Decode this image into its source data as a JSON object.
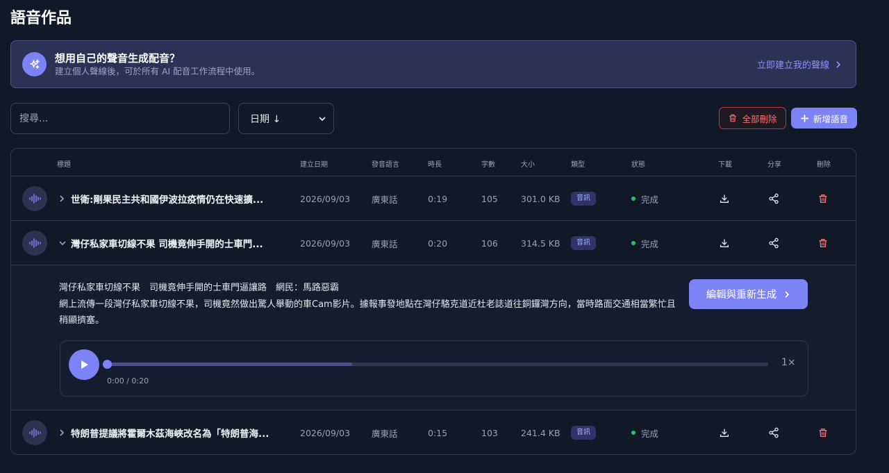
{
  "page": {
    "title": "語音作品"
  },
  "banner": {
    "title": "想用自己的聲音生成配音？",
    "subtitle": "建立個人聲線後，可於所有 AI 配音工作流程中使用。",
    "link_label": "立即建立我的聲線",
    "icon": "sparkles-icon"
  },
  "toolbar": {
    "search_placeholder": "搜尋...",
    "sort_label": "日期 ↓",
    "delete_all_label": "全部刪除",
    "new_label": "新增語音"
  },
  "table": {
    "headers": {
      "title": "標題",
      "date": "建立日期",
      "language": "發音語言",
      "duration": "時長",
      "chars": "字數",
      "size": "大小",
      "type": "類型",
      "status": "狀態",
      "download": "下載",
      "share": "分享",
      "delete": "刪除"
    },
    "rows": [
      {
        "title": "世衛:剛果民主共和國伊波拉疫情仍在快速擴...",
        "date": "2026/09/03",
        "language": "廣東話",
        "duration": "0:19",
        "chars": "105",
        "size": "301.0 KB",
        "type": "音訊",
        "status": "完成",
        "expanded": false
      },
      {
        "title": "灣仔私家車切線不果 司機竟伸手開的士車門...",
        "date": "2026/09/03",
        "language": "廣東話",
        "duration": "0:20",
        "chars": "106",
        "size": "314.5 KB",
        "type": "音訊",
        "status": "完成",
        "expanded": true
      },
      {
        "title": "特朗普提議將霍爾木茲海峽改名為「特朗普海...",
        "date": "2026/09/03",
        "language": "廣東話",
        "duration": "0:15",
        "chars": "103",
        "size": "241.4 KB",
        "type": "音訊",
        "status": "完成",
        "expanded": false
      }
    ]
  },
  "expanded": {
    "full_title": "灣仔私家車切線不果　司機竟伸手開的士車門逼讓路　網民：馬路惡霸",
    "description": "網上流傳一段灣仔私家車切線不果，司機竟然做出驚人舉動的車Cam影片。據報事發地點在灣仔駱克道近杜老誌道往銅鑼灣方向，當時路面交通相當繁忙且稍顯擠塞。",
    "regen_label": "編輯與重新生成",
    "player": {
      "time": "0:00 / 0:20",
      "speed": "1×",
      "progress": 0.0,
      "buffered": 0.37
    }
  },
  "colors": {
    "accent": "#7c83f5",
    "danger": "#f87171",
    "success": "#22c55e"
  }
}
